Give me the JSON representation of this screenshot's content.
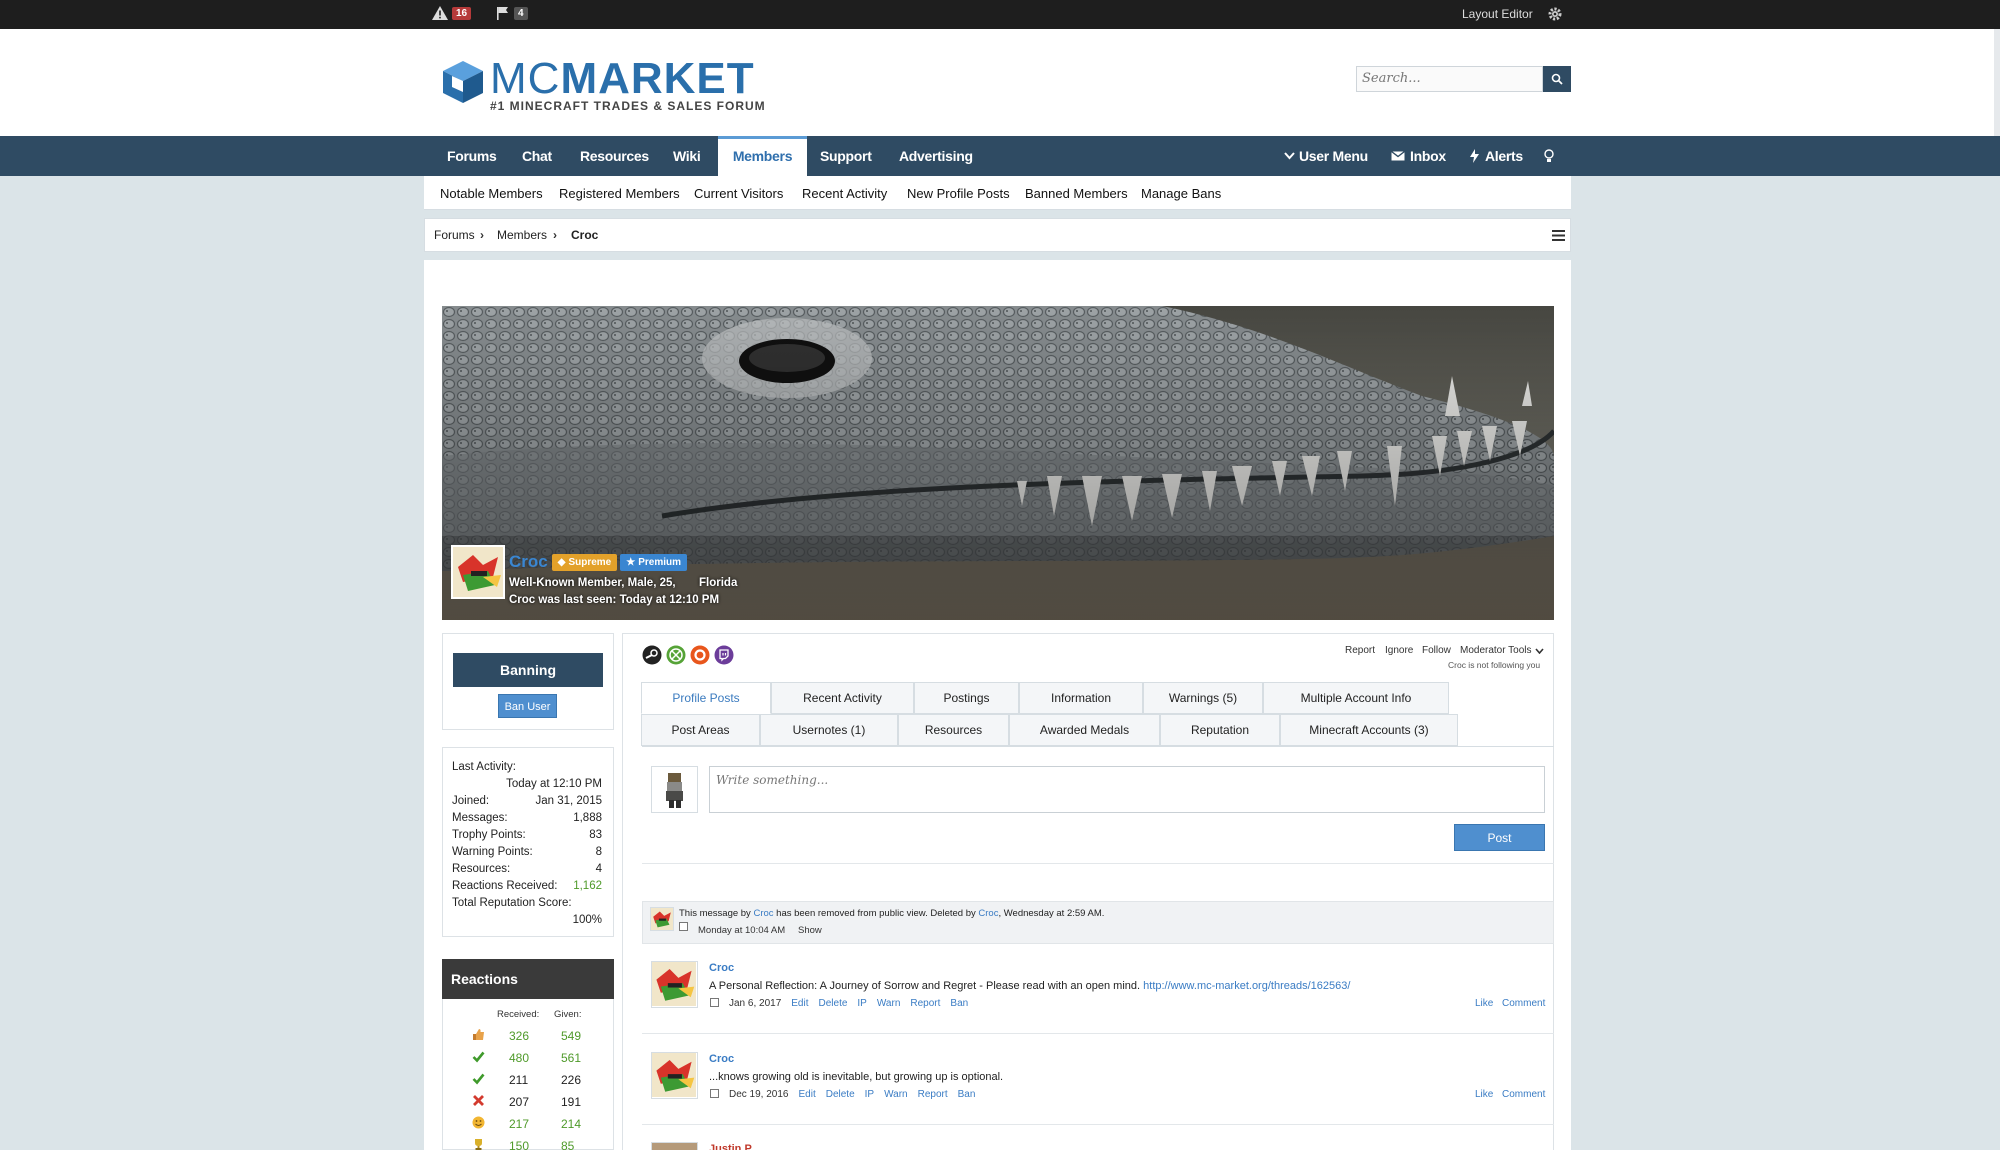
{
  "adminbar": {
    "warnings_count": "16",
    "reports_count": "4",
    "layout_editor": "Layout Editor"
  },
  "header": {
    "logo_mc": "MC",
    "logo_market": "MARKET",
    "tagline": "#1 MINECRAFT TRADES & SALES FORUM",
    "search_placeholder": "Search..."
  },
  "nav": {
    "tabs": [
      "Forums",
      "Chat",
      "Resources",
      "Wiki",
      "Members",
      "Support",
      "Advertising"
    ],
    "user_menu": "User Menu",
    "inbox": "Inbox",
    "alerts": "Alerts"
  },
  "subnav": [
    "Notable Members",
    "Registered Members",
    "Current Visitors",
    "Recent Activity",
    "New Profile Posts",
    "Banned Members",
    "Manage Bans"
  ],
  "breadcrumb": [
    "Forums",
    "Members",
    "Croc"
  ],
  "profile": {
    "username": "Croc",
    "badge_supreme": "Supreme",
    "badge_premium": "Premium",
    "info_line": "Well-Known Member, Male, 25,",
    "location": "Florida",
    "last_seen": "Croc was last seen: Today at 12:10 PM"
  },
  "sidebar": {
    "banning_title": "Banning",
    "ban_user": "Ban User",
    "stats": [
      {
        "label": "Last Activity:",
        "value": ""
      },
      {
        "label": "",
        "value": "Today at 12:10 PM"
      },
      {
        "label": "Joined:",
        "value": "Jan 31, 2015"
      },
      {
        "label": "Messages:",
        "value": "1,888"
      },
      {
        "label": "Trophy Points:",
        "value": "83"
      },
      {
        "label": "Warning Points:",
        "value": "8"
      },
      {
        "label": "Resources:",
        "value": "4"
      },
      {
        "label": "Reactions Received:",
        "value": "1,162"
      },
      {
        "label": "Total Reputation Score:",
        "value": ""
      },
      {
        "label": "",
        "value": "100%"
      }
    ],
    "reactions_title": "Reactions",
    "reactions_head_received": "Received:",
    "reactions_head_given": "Given:",
    "reactions": [
      {
        "icon": "thumbs-up",
        "received": "326",
        "given": "549"
      },
      {
        "icon": "check",
        "received": "480",
        "given": "561"
      },
      {
        "icon": "check",
        "received": "211",
        "given": "226"
      },
      {
        "icon": "cross",
        "received": "207",
        "given": "191"
      },
      {
        "icon": "smile",
        "received": "217",
        "given": "214"
      },
      {
        "icon": "trophy",
        "received": "150",
        "given": "85"
      }
    ]
  },
  "actions": {
    "report": "Report",
    "ignore": "Ignore",
    "follow": "Follow",
    "moderator_tools": "Moderator Tools",
    "not_following": "Croc is not following you"
  },
  "tabs_row1": [
    "Profile Posts",
    "Recent Activity",
    "Postings",
    "Information",
    "Warnings (5)",
    "Multiple Account Info"
  ],
  "tabs_row2": [
    "Post Areas",
    "Usernotes (1)",
    "Resources",
    "Awarded Medals",
    "Reputation",
    "Minecraft Accounts (3)"
  ],
  "composer": {
    "placeholder": "Write something...",
    "post_button": "Post"
  },
  "deleted_notice": {
    "pre": "This message by ",
    "user1": "Croc",
    "mid": " has been removed from public view. Deleted by ",
    "user2": "Croc",
    "post": ", Wednesday at 2:59 AM.",
    "date": "Monday at 10:04 AM",
    "show": "Show"
  },
  "posts": [
    {
      "author": "Croc",
      "text": "A Personal Reflection: A Journey of Sorrow and Regret - Please read with an open mind. ",
      "link": "http://www.mc-market.org/threads/162563/",
      "date": "Jan 6, 2017",
      "actions": [
        "Edit",
        "Delete",
        "IP",
        "Warn",
        "Report",
        "Ban"
      ],
      "like": "Like",
      "comment": "Comment"
    },
    {
      "author": "Croc",
      "text": "...knows growing old is inevitable, but growing up is optional.",
      "link": "",
      "date": "Dec 19, 2016",
      "actions": [
        "Edit",
        "Delete",
        "IP",
        "Warn",
        "Report",
        "Ban"
      ],
      "like": "Like",
      "comment": "Comment"
    }
  ],
  "next_post_author": "Justin P."
}
